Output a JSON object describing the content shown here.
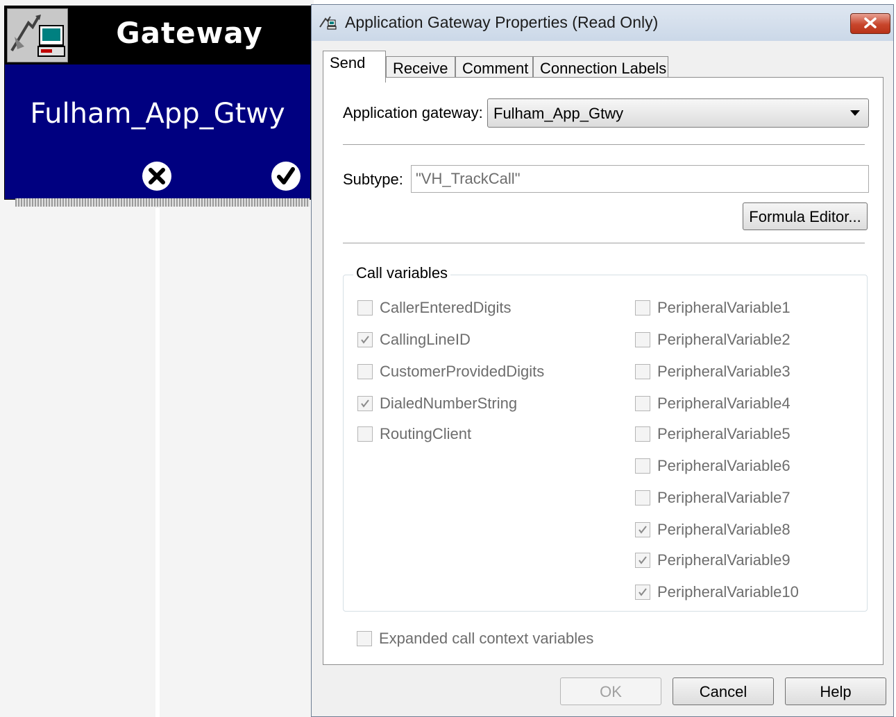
{
  "node": {
    "title": "Gateway",
    "name": "Fulham_App_Gtwy",
    "icon": "gateway-computer-icon"
  },
  "dialog": {
    "title": "Application Gateway Properties (Read Only)",
    "tabs": [
      {
        "label": "Send",
        "active": true
      },
      {
        "label": "Receive",
        "active": false
      },
      {
        "label": "Comment",
        "active": false
      },
      {
        "label": "Connection Labels",
        "active": false
      }
    ],
    "app_gateway_label": "Application gateway:",
    "app_gateway_value": "Fulham_App_Gtwy",
    "subtype_label": "Subtype:",
    "subtype_value": "\"VH_TrackCall\"",
    "formula_editor_label": "Formula Editor...",
    "call_variables_title": "Call variables",
    "left_vars": [
      {
        "label": "CallerEnteredDigits",
        "checked": false
      },
      {
        "label": "CallingLineID",
        "checked": true
      },
      {
        "label": "CustomerProvidedDigits",
        "checked": false
      },
      {
        "label": "DialedNumberString",
        "checked": true
      },
      {
        "label": "RoutingClient",
        "checked": false
      }
    ],
    "right_vars": [
      {
        "label": "PeripheralVariable1",
        "checked": false
      },
      {
        "label": "PeripheralVariable2",
        "checked": false
      },
      {
        "label": "PeripheralVariable3",
        "checked": false
      },
      {
        "label": "PeripheralVariable4",
        "checked": false
      },
      {
        "label": "PeripheralVariable5",
        "checked": false
      },
      {
        "label": "PeripheralVariable6",
        "checked": false
      },
      {
        "label": "PeripheralVariable7",
        "checked": false
      },
      {
        "label": "PeripheralVariable8",
        "checked": true
      },
      {
        "label": "PeripheralVariable9",
        "checked": true
      },
      {
        "label": "PeripheralVariable10",
        "checked": true
      }
    ],
    "expanded_label": "Expanded call context variables",
    "expanded_checked": false,
    "buttons": {
      "ok": "OK",
      "cancel": "Cancel",
      "help": "Help"
    }
  },
  "colors": {
    "node_body": "#000080",
    "node_header": "#000000",
    "disabled_text": "#6d6d6d"
  }
}
